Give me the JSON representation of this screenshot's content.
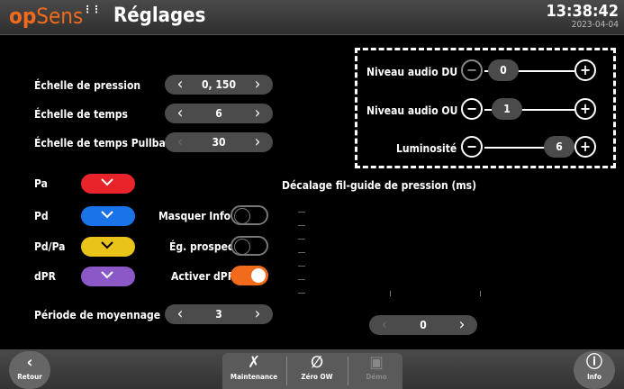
{
  "header": {
    "logo_op": "op",
    "logo_sens": "Sens",
    "title": "Réglages",
    "time": "13:38:42",
    "date": "2023-04-04"
  },
  "settings": {
    "pressure_scale": {
      "label": "Échelle de pression",
      "value": "0, 150"
    },
    "time_scale": {
      "label": "Échelle de temps",
      "value": "6"
    },
    "pullback_scale": {
      "label": "Échelle de temps Pullback",
      "value": "30"
    },
    "averaging_period": {
      "label": "Période de moyennage",
      "value": "3"
    }
  },
  "colors": [
    {
      "label": "Pa",
      "color": "#e8232a"
    },
    {
      "label": "Pd",
      "color": "#1a73e8"
    },
    {
      "label": "Pd/Pa",
      "color": "#e9c21a"
    },
    {
      "label": "dPR",
      "color": "#8b58c7"
    }
  ],
  "toggles": [
    {
      "label": "Masquer Info P.",
      "on": false
    },
    {
      "label": "Ég. prospect.",
      "on": false
    },
    {
      "label": "Activer dPR",
      "on": true
    }
  ],
  "audio": {
    "du": {
      "label": "Niveau audio DU",
      "value": "0",
      "level": 0.0
    },
    "ou": {
      "label": "Niveau audio OU",
      "value": "1",
      "level": 0.1
    },
    "brightness": {
      "label": "Luminosité",
      "value": "6",
      "level": 1.0
    }
  },
  "offset": {
    "label": "Décalage fil-guide de pression (ms)",
    "value": "0"
  },
  "footer": {
    "back": "Retour",
    "maintenance": "Maintenance",
    "zero": "Zéro OW",
    "demo": "Démo",
    "info": "Info"
  },
  "accent": "#f26a1b"
}
